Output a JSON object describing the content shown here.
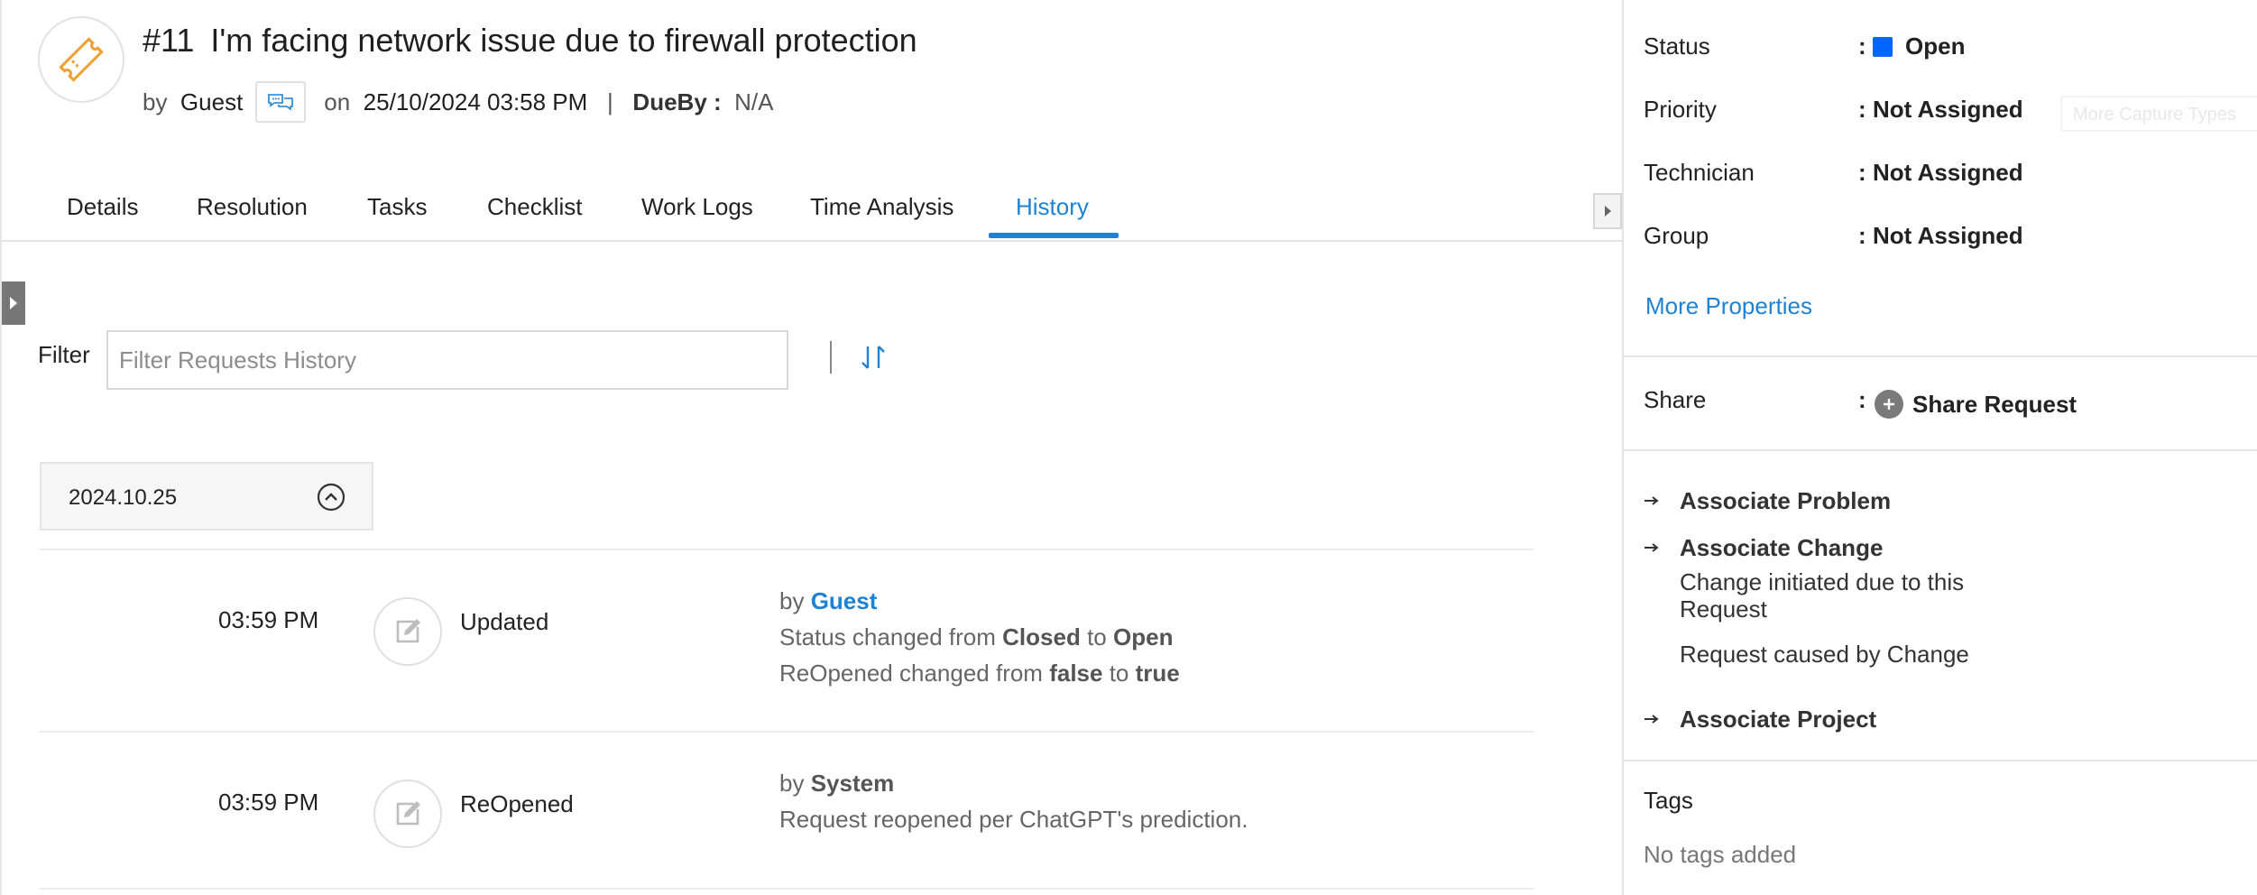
{
  "header": {
    "number": "#11",
    "title": "I'm facing network issue due to firewall protection",
    "by_label": "by",
    "requester": "Guest",
    "on_label": "on",
    "created": "25/10/2024 03:58 PM",
    "separator": "|",
    "dueby_label": "DueBy :",
    "dueby_value": "N/A"
  },
  "tabs": [
    {
      "label": "Details"
    },
    {
      "label": "Resolution"
    },
    {
      "label": "Tasks"
    },
    {
      "label": "Checklist"
    },
    {
      "label": "Work Logs"
    },
    {
      "label": "Time Analysis"
    },
    {
      "label": "History",
      "active": true
    }
  ],
  "filter": {
    "label": "Filter",
    "placeholder": "Filter Requests History",
    "value": ""
  },
  "history": {
    "date": "2024.10.25",
    "entries": [
      {
        "time": "03:59 PM",
        "action": "Updated",
        "by_label": "by",
        "by": "Guest",
        "line1": {
          "prefix": "Status changed from",
          "from": "Closed",
          "to_word": "to",
          "to": "Open"
        },
        "line2": {
          "prefix": "ReOpened changed from",
          "from": "false",
          "to_word": "to",
          "to": "true"
        }
      },
      {
        "time": "03:59 PM",
        "action": "ReOpened",
        "by_label": "by",
        "by": "System",
        "note": "Request reopened per ChatGPT's prediction."
      }
    ]
  },
  "properties": {
    "colon": ":",
    "status": {
      "label": "Status",
      "value": "Open",
      "color": "#0066ff"
    },
    "priority": {
      "label": "Priority",
      "value": "Not Assigned"
    },
    "technician": {
      "label": "Technician",
      "value": "Not Assigned"
    },
    "group": {
      "label": "Group",
      "value": "Not Assigned"
    },
    "ghost_button": "More Capture Types",
    "more_link": "More Properties"
  },
  "share": {
    "label": "Share",
    "button": "Share Request"
  },
  "associate": {
    "problem": "Associate Problem",
    "change": "Associate Change",
    "change_sub1": "Change initiated due to this Request",
    "change_sub2": "Request caused by Change",
    "project": "Associate Project"
  },
  "tags": {
    "label": "Tags",
    "empty": "No tags added"
  },
  "colors": {
    "accent": "#1f82d2",
    "status_open": "#0066ff",
    "ticket_icon": "#f0a030"
  },
  "icons": {
    "ticket": "ticket-icon",
    "chat": "conversation-icon",
    "sort": "sort-icon",
    "collapse": "chevron-up-icon",
    "edit": "edit-icon",
    "plus": "plus-icon",
    "arrow": "arrow-right-icon"
  }
}
